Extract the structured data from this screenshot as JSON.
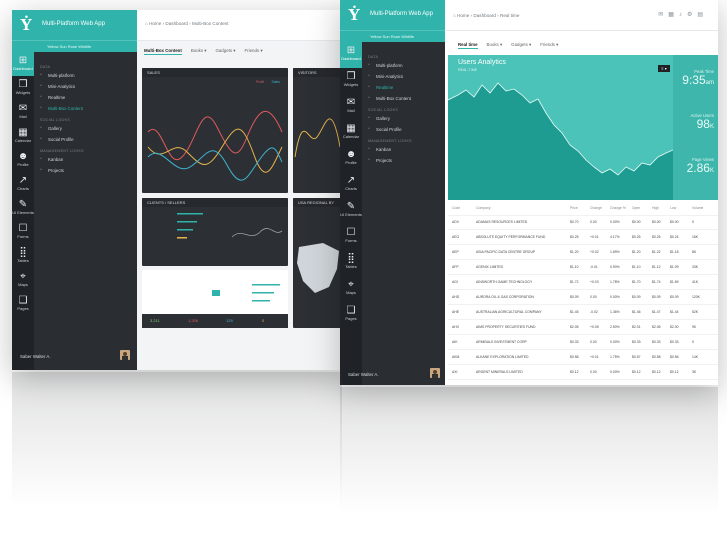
{
  "app": {
    "title": "Multi-Platform Web App",
    "logo_glyph": "Ẏ"
  },
  "left_window": {
    "profile_label": "Yellow Sun Rose Wildlife",
    "breadcrumb": {
      "home": "Home",
      "dashboard": "Dashboard",
      "page": "Multi-Box Content"
    },
    "tabs": [
      {
        "label": "Multi-Box Content"
      },
      {
        "label": "Books ▾"
      },
      {
        "label": "Gadgets ▾"
      },
      {
        "label": "Friends ▾"
      }
    ],
    "icon_nav": [
      {
        "label": "Dashboard",
        "glyph": "⊞",
        "active": true
      },
      {
        "label": "Widgets",
        "glyph": "❒",
        "active": false
      },
      {
        "label": "Mail",
        "glyph": "✉",
        "active": false
      },
      {
        "label": "Calendar",
        "glyph": "▦",
        "active": false
      },
      {
        "label": "Profile",
        "glyph": "☻",
        "active": false
      },
      {
        "label": "Charts",
        "glyph": "↗",
        "active": false
      },
      {
        "label": "UI Elements",
        "glyph": "✎",
        "active": false
      },
      {
        "label": "Forms",
        "glyph": "☐",
        "active": false
      },
      {
        "label": "Tables",
        "glyph": "⣿",
        "active": false
      },
      {
        "label": "Maps",
        "glyph": "⌖",
        "active": false
      },
      {
        "label": "Pages",
        "glyph": "❑",
        "active": false
      }
    ],
    "menu": [
      {
        "section": "DATA",
        "items": [
          {
            "label": "Multi-platform",
            "on": false
          },
          {
            "label": "Mini-Analytics",
            "on": false
          },
          {
            "label": "Realtime",
            "on": false
          },
          {
            "label": "Multi-Box Content",
            "on": true
          }
        ]
      },
      {
        "section": "SOCIAL LOOKS",
        "items": [
          {
            "label": "Gallery",
            "on": false
          },
          {
            "label": "Social Profile",
            "on": false
          }
        ]
      },
      {
        "section": "MANAGEMENT LOOKS",
        "items": [
          {
            "label": "Kanban",
            "on": false
          },
          {
            "label": "Projects",
            "on": false
          }
        ]
      }
    ],
    "user": {
      "name": "Saber Walter A."
    },
    "cards": {
      "sales": "SALES",
      "visitors": "VISITORS",
      "clients": "CLIENTS / SELLERS",
      "usa": "USA REGIONAL BY"
    },
    "sales_legend": [
      "Profit",
      "Sales"
    ],
    "bottom_stats": [
      "3,211",
      "1,206",
      "125",
      "0"
    ]
  },
  "right_window": {
    "profile_label": "Yellow Sun Rose Wildlife",
    "breadcrumb": {
      "home": "Home",
      "dashboard": "Dashboard",
      "page": "Real time"
    },
    "tabs": [
      {
        "label": "Real time"
      },
      {
        "label": "Books ▾"
      },
      {
        "label": "Gadgets ▾"
      },
      {
        "label": "Friends ▾"
      }
    ],
    "icon_nav": [
      {
        "label": "Dashboard",
        "glyph": "⊞",
        "active": true
      },
      {
        "label": "Widgets",
        "glyph": "❒",
        "active": false
      },
      {
        "label": "Mail",
        "glyph": "✉",
        "active": false
      },
      {
        "label": "Calendar",
        "glyph": "▦",
        "active": false
      },
      {
        "label": "Profile",
        "glyph": "☻",
        "active": false
      },
      {
        "label": "Charts",
        "glyph": "↗",
        "active": false
      },
      {
        "label": "UI Elements",
        "glyph": "✎",
        "active": false
      },
      {
        "label": "Forms",
        "glyph": "☐",
        "active": false
      },
      {
        "label": "Tables",
        "glyph": "⣿",
        "active": false
      },
      {
        "label": "Maps",
        "glyph": "⌖",
        "active": false
      },
      {
        "label": "Pages",
        "glyph": "❑",
        "active": false
      }
    ],
    "menu": [
      {
        "section": "DATA",
        "items": [
          {
            "label": "Multi-platform",
            "on": false
          },
          {
            "label": "Mini-Analytics",
            "on": false
          },
          {
            "label": "Realtime",
            "on": true
          },
          {
            "label": "Multi-Box Content",
            "on": false
          }
        ]
      },
      {
        "section": "SOCIAL LOOKS",
        "items": [
          {
            "label": "Gallery",
            "on": false
          },
          {
            "label": "Social Profile",
            "on": false
          }
        ]
      },
      {
        "section": "MANAGEMENT LOOKS",
        "items": [
          {
            "label": "Kanban",
            "on": false
          },
          {
            "label": "Projects",
            "on": false
          }
        ]
      }
    ],
    "user": {
      "name": "Saber Walter A."
    },
    "analytics": {
      "title": "Users Analytics",
      "subtitle": "REAL-TIME",
      "stats": [
        {
          "label": "Peak Time",
          "value": "9:35",
          "unit": "am"
        },
        {
          "label": "Active Users",
          "value": "98",
          "unit": "K"
        },
        {
          "label": "Page Views",
          "value": "2.86",
          "unit": "K"
        }
      ]
    },
    "table": {
      "headers": [
        "Code",
        "Company",
        "Price",
        "Change",
        "Change %",
        "Open",
        "High",
        "Low",
        "Volume"
      ],
      "rows": [
        [
          "ADV",
          "ADAMUS RESOURCES LIMITED",
          "$0.70",
          "0.00",
          "0.00%",
          "$0.00",
          "$0.00",
          "$0.00",
          "0"
        ],
        [
          "AEG",
          "ABSOLUTE EQUITY PERFORMANCE FUND",
          "$0.25",
          "+0.01",
          "4.17%",
          "$0.25",
          "$0.25",
          "$0.24",
          "16K"
        ],
        [
          "AEP",
          "ASIA PACIFIC DATA CENTRE GROUP",
          "$1.20",
          "+0.02",
          "1.69%",
          "$1.20",
          "$1.22",
          "$1.18",
          "8K"
        ],
        [
          "AFP",
          "AGENIX LIMITED",
          "$1.10",
          "-0.01",
          "0.90%",
          "$1.10",
          "$1.12",
          "$1.09",
          "33K"
        ],
        [
          "AGI",
          "AINSWORTH GAME TECHNOLOGY",
          "$1.72",
          "+0.03",
          "1.78%",
          "$1.70",
          "$1.74",
          "$1.69",
          "41K"
        ],
        [
          "AHD",
          "AURORA OIL & GAS CORPORATION",
          "$0.09",
          "0.00",
          "0.00%",
          "$0.09",
          "$0.09",
          "$0.09",
          "120K"
        ],
        [
          "AHE",
          "AUSTRALIAN AGRICULTURAL COMPANY",
          "$1.45",
          "-0.02",
          "1.36%",
          "$1.46",
          "$1.47",
          "$1.44",
          "52K"
        ],
        [
          "AHX",
          "AIMS PROPERTY SECURITIES FUND",
          "$2.05",
          "+0.05",
          "2.50%",
          "$2.01",
          "$2.06",
          "$2.00",
          "9K"
        ],
        [
          "AIK",
          "ARMIDALE INVESTMENT CORP",
          "$0.33",
          "0.00",
          "0.00%",
          "$0.33",
          "$0.33",
          "$0.33",
          "0"
        ],
        [
          "AKM",
          "ALKANE EXPLORATION LIMITED",
          "$0.58",
          "+0.01",
          "1.75%",
          "$0.57",
          "$0.58",
          "$0.56",
          "14K"
        ],
        [
          "AXI",
          "ARGENT MINERALS LIMITED",
          "$0.12",
          "0.00",
          "0.00%",
          "$0.12",
          "$0.12",
          "$0.12",
          "3K"
        ]
      ]
    }
  },
  "colors": {
    "teal": "#2fb3aa",
    "sidebar": "#2a2d31",
    "content_bg": "#f4f6f7"
  }
}
